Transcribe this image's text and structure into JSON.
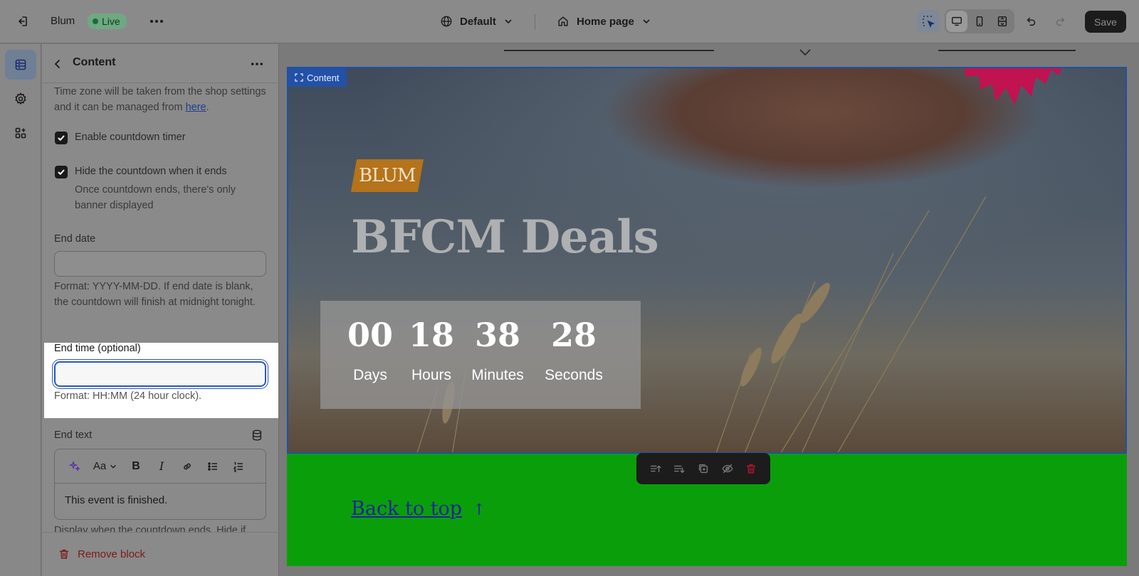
{
  "topbar": {
    "store_name": "Blum",
    "status_badge": "Live",
    "theme_select": "Default",
    "page_select": "Home page",
    "save_label": "Save"
  },
  "panel": {
    "title": "Content",
    "timezone_text_1": "Time zone will be taken from the shop settings and it can be managed from ",
    "timezone_link": "here",
    "timezone_text_2": ".",
    "enable_countdown_label": "Enable countdown timer",
    "hide_countdown_label": "Hide the countdown when it ends",
    "hide_countdown_help": "Once countdown ends, there's only banner displayed",
    "end_date_label": "End date",
    "end_date_value": "",
    "end_date_help": "Format: YYYY-MM-DD. If end date is blank, the countdown will finish at midnight tonight.",
    "end_time_label": "End time (optional)",
    "end_time_value": "",
    "end_time_help": "Format: HH:MM (24 hour clock).",
    "end_text_label": "End text",
    "end_text_value": "This event is finished.",
    "end_text_help": "Display when the countdown ends. Hide if",
    "remove_block": "Remove block",
    "rte_font_label": "Aa"
  },
  "preview": {
    "content_tag": "Content",
    "logo_text": "BLUM",
    "headline": "BFCM Deals",
    "countdown": [
      {
        "value": "00",
        "label": "Days"
      },
      {
        "value": "18",
        "label": "Hours"
      },
      {
        "value": "38",
        "label": "Minutes"
      },
      {
        "value": "28",
        "label": "Seconds"
      }
    ],
    "back_to_top": "Back to top",
    "back_to_top_arrow": "↑"
  },
  "colors": {
    "accent": "#2a56c6",
    "green_section": "#0b9e0b",
    "logo_bg": "#b5731b",
    "starburst": "#c0134f"
  }
}
